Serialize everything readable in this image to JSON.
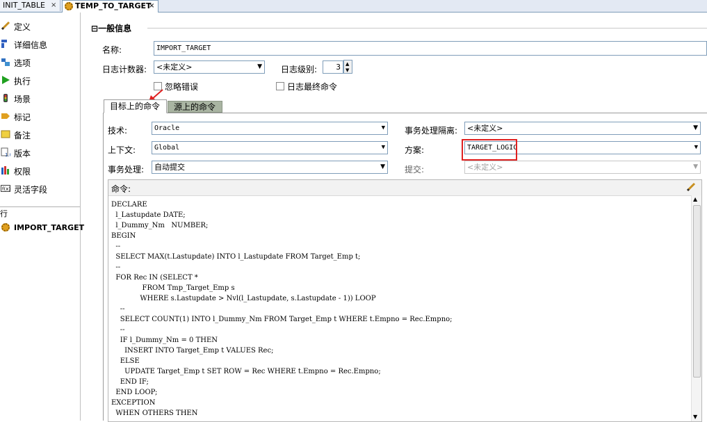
{
  "tabs": [
    {
      "label": "INIT_TABLE",
      "close": "×"
    },
    {
      "label": "TEMP_TO_TARGET",
      "close": "×"
    }
  ],
  "sidebar": {
    "items": [
      {
        "label": "定义",
        "icon": "pencil-icon"
      },
      {
        "label": "详细信息",
        "icon": "details-icon"
      },
      {
        "label": "选项",
        "icon": "options-icon"
      },
      {
        "label": "执行",
        "icon": "run-icon"
      },
      {
        "label": "场景",
        "icon": "scenario-icon"
      },
      {
        "label": "标记",
        "icon": "tag-icon"
      },
      {
        "label": "备注",
        "icon": "note-icon"
      },
      {
        "label": "版本",
        "icon": "version-icon"
      },
      {
        "label": "权限",
        "icon": "permission-icon"
      },
      {
        "label": "灵活字段",
        "icon": "flexfield-icon"
      }
    ],
    "sub_label": "行",
    "bottom_item": "IMPORT_TARGET"
  },
  "general": {
    "section_title": "一般信息",
    "collapse_symbol": "⊟",
    "name_label": "名称:",
    "name_value": "IMPORT_TARGET",
    "log_counter_label": "日志计数器:",
    "log_counter_value": "<未定义>",
    "log_level_label": "日志级别:",
    "log_level_value": "3",
    "ignore_errors_label": "忽略错误",
    "log_final_command_label": "日志最终命令"
  },
  "subtabs": {
    "target": "目标上的命令",
    "source": "源上的命令"
  },
  "target": {
    "technology_label": "技术:",
    "technology_value": "Oracle",
    "context_label": "上下文:",
    "context_value": "Global",
    "transaction_label": "事务处理:",
    "transaction_value": "自动提交",
    "isolation_label": "事务处理隔离:",
    "isolation_value": "<未定义>",
    "schema_label": "方案:",
    "schema_value": "TARGET_LOGIC",
    "commit_label": "提交:",
    "commit_value": "<未定义>"
  },
  "command": {
    "label": "命令:",
    "lines": [
      "DECLARE",
      "  l_Lastupdate DATE;",
      "  l_Dummy_Nm   NUMBER;",
      "BEGIN",
      "  --",
      "  SELECT MAX(t.Lastupdate) INTO l_Lastupdate FROM Target_Emp t;",
      "  --",
      "  FOR Rec IN (SELECT *",
      "              FROM Tmp_Target_Emp s",
      "             WHERE s.Lastupdate > Nvl(l_Lastupdate, s.Lastupdate - 1)) LOOP",
      "    --",
      "    SELECT COUNT(1) INTO l_Dummy_Nm FROM Target_Emp t WHERE t.Empno = Rec.Empno;",
      "    --",
      "    IF l_Dummy_Nm = 0 THEN",
      "      INSERT INTO Target_Emp t VALUES Rec;",
      "    ELSE",
      "      UPDATE Target_Emp t SET ROW = Rec WHERE t.Empno = Rec.Empno;",
      "    END IF;",
      "  END LOOP;",
      "EXCEPTION",
      "  WHEN OTHERS THEN"
    ]
  },
  "colors": {
    "highlight": "#e02020",
    "inactive_tab": "#a9b4a2"
  }
}
